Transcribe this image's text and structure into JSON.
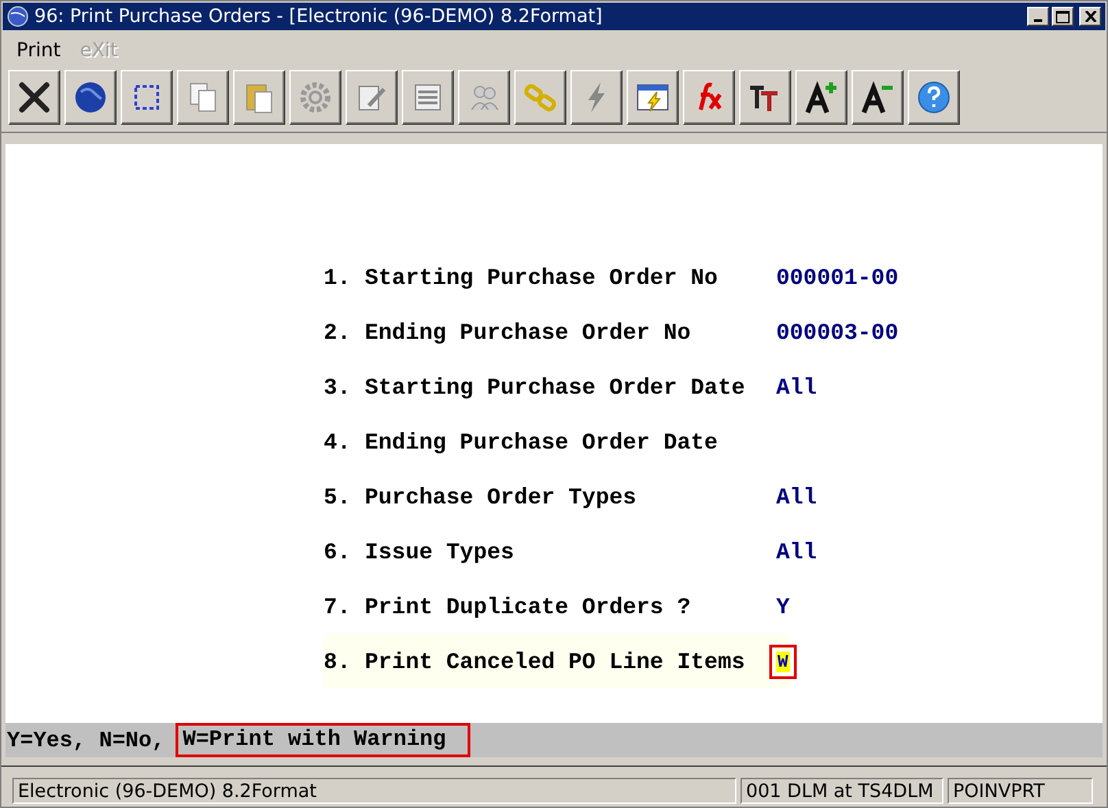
{
  "window": {
    "title": "96: Print Purchase Orders - [Electronic (96-DEMO) 8.2Format]"
  },
  "menu": [
    {
      "label": "Print",
      "disabled": false
    },
    {
      "label": "eXit",
      "disabled": true
    }
  ],
  "toolbar": [
    {
      "kind": "close"
    },
    {
      "kind": "globe"
    },
    {
      "kind": "select"
    },
    {
      "kind": "copy"
    },
    {
      "kind": "paste"
    },
    {
      "kind": "gear"
    },
    {
      "kind": "edit"
    },
    {
      "kind": "list"
    },
    {
      "kind": "people"
    },
    {
      "kind": "chain"
    },
    {
      "kind": "lightning"
    },
    {
      "kind": "window-lightning"
    },
    {
      "kind": "fx"
    },
    {
      "kind": "font-size"
    },
    {
      "kind": "font-up"
    },
    {
      "kind": "font-down"
    },
    {
      "kind": "help"
    }
  ],
  "fields": [
    {
      "number": "1.",
      "label": "Starting Purchase Order No",
      "value": "000001-00",
      "focused": false
    },
    {
      "number": "2.",
      "label": "Ending Purchase Order No",
      "value": "000003-00",
      "focused": false
    },
    {
      "number": "3.",
      "label": "Starting Purchase Order Date",
      "value": "All",
      "focused": false
    },
    {
      "number": "4.",
      "label": "Ending Purchase Order Date",
      "focused": false
    },
    {
      "number": "5.",
      "label": "Purchase Order Types",
      "value": "All",
      "focused": false
    },
    {
      "number": "6.",
      "label": "Issue Types",
      "value": "All",
      "focused": false
    },
    {
      "number": "7.",
      "label": "Print Duplicate Orders ?",
      "value": "Y",
      "focused": false
    },
    {
      "number": "8.",
      "label": "Print Canceled PO Line Items",
      "value": "W",
      "focused": true
    }
  ],
  "hint": [
    {
      "text": "Y=Yes, N=No,",
      "outlined": false
    },
    {
      "text": "W=Print with Warning",
      "outlined": true
    }
  ],
  "status_bar": [
    {
      "text": "Electronic (96-DEMO) 8.2Format"
    },
    {
      "text": "001 DLM at TS4DLM"
    },
    {
      "text": "POINVPRT"
    }
  ]
}
